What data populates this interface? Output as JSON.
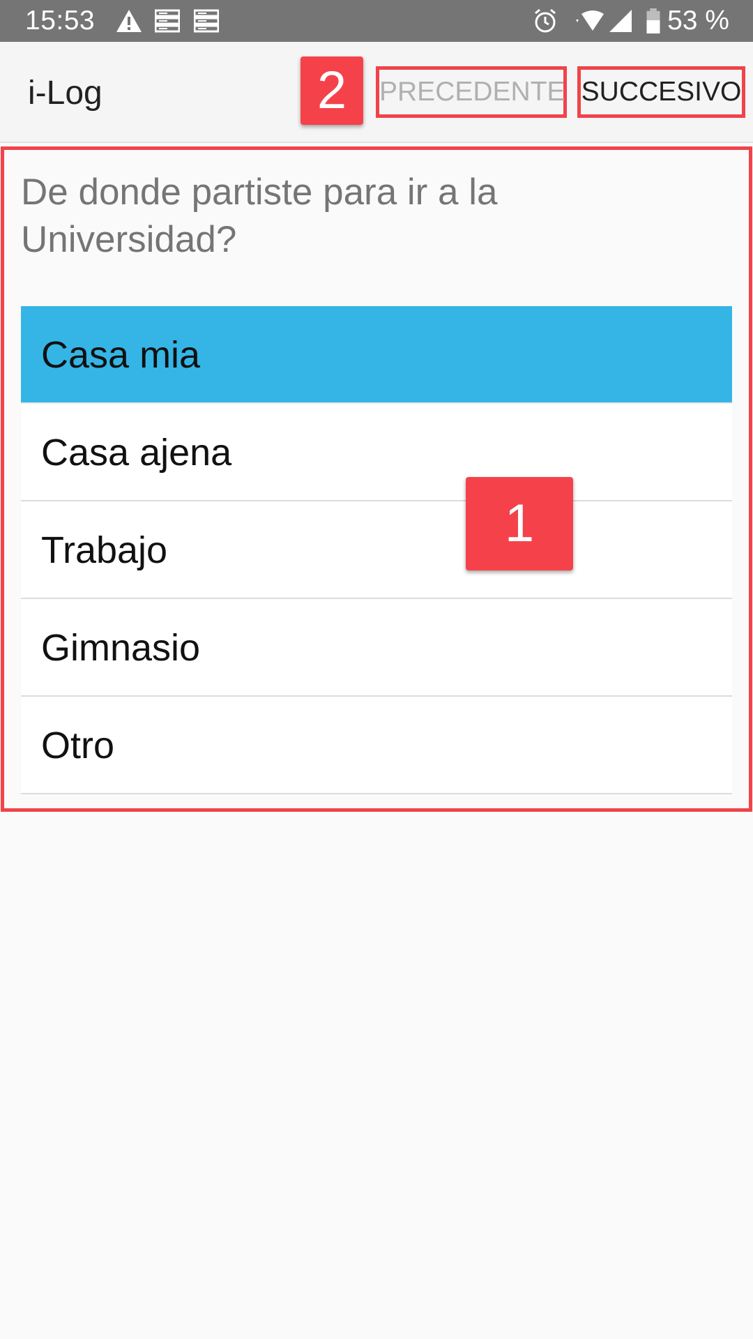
{
  "status_bar": {
    "time": "15:53",
    "battery": "53 %",
    "icons": [
      "warning-icon",
      "notification-icon",
      "notification-icon",
      "alarm-icon",
      "wifi-icon",
      "signal-icon",
      "battery-icon"
    ]
  },
  "app_bar": {
    "title": "i-Log",
    "prev_label": "PRECEDENTE",
    "next_label": "SUCCESIVO"
  },
  "question": "De donde partiste para ir a la Universidad?",
  "options": [
    {
      "label": "Casa mia",
      "selected": true
    },
    {
      "label": "Casa ajena",
      "selected": false
    },
    {
      "label": "Trabajo",
      "selected": false
    },
    {
      "label": "Gimnasio",
      "selected": false
    },
    {
      "label": "Otro",
      "selected": false
    }
  ],
  "annotations": {
    "badge_1": "1",
    "badge_2": "2"
  },
  "colors": {
    "status_bar": "#757575",
    "selected": "#35b5e5",
    "annotation": "#f5424a",
    "disabled_text": "#b0b0b0"
  }
}
